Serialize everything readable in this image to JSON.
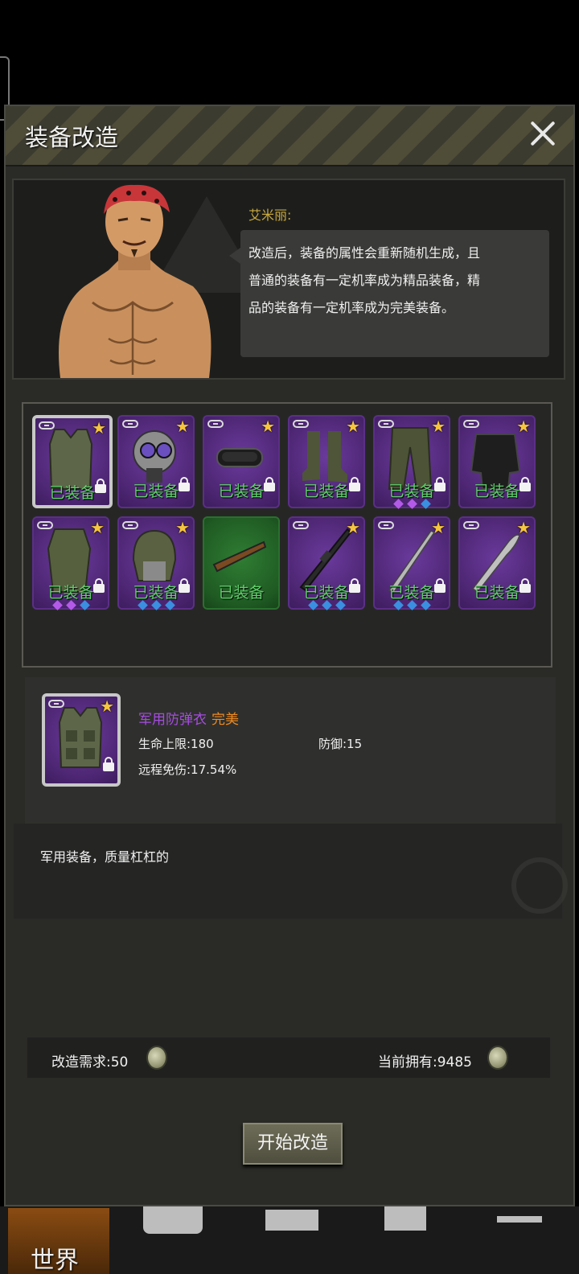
{
  "dialog": {
    "title": "装备改造"
  },
  "npc": {
    "name": "艾米丽:",
    "lines": [
      "改造后，装备的属性会重新随机生成，且",
      "普通的装备有一定机率成为精品装备，精",
      "品的装备有一定机率成为完美装备。"
    ]
  },
  "inventory": {
    "slots": [
      {
        "label": "已装备",
        "gems": []
      },
      {
        "label": "已装备",
        "gems": []
      },
      {
        "label": "已装备",
        "gems": []
      },
      {
        "label": "已装备",
        "gems": []
      },
      {
        "label": "已装备",
        "gems": [
          "purple",
          "purple",
          "blue"
        ]
      },
      {
        "label": "已装备",
        "gems": []
      },
      {
        "label": "已装备",
        "gems": [
          "purple",
          "purple",
          "blue"
        ]
      },
      {
        "label": "已装备",
        "gems": [
          "blue",
          "blue",
          "blue"
        ]
      },
      {
        "label": "已装备",
        "gems": []
      },
      {
        "label": "已装备",
        "gems": [
          "blue",
          "blue",
          "blue"
        ]
      },
      {
        "label": "已装备",
        "gems": [
          "blue",
          "blue",
          "blue"
        ]
      },
      {
        "label": "已装备",
        "gems": []
      }
    ]
  },
  "detail": {
    "item_name": "军用防弹衣",
    "item_quality": "完美",
    "stats": {
      "hp_label": "生命上限:180",
      "defense_label": "防御:15",
      "ranged_label": "远程免伤:17.54%"
    },
    "description": "军用装备，质量杠杠的"
  },
  "cost": {
    "required_label": "改造需求:50",
    "owned_label": "当前拥有:9485"
  },
  "actions": {
    "start_label": "开始改造"
  },
  "nav": {
    "world_label": "世界"
  },
  "colors": {
    "name_purple": "#a64ce0",
    "quality_orange": "#f08a1e",
    "equipped_green": "#5fd06a",
    "star_gold": "#f5c53d"
  }
}
